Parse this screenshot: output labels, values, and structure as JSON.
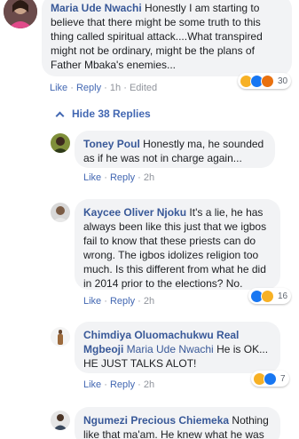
{
  "comments": [
    {
      "author": "Maria Ude Nwachi",
      "text": "Honestly I am starting to believe that there might be some truth to this thing called spiritual attack....What transpired might not be ordinary, might be the plans of Father Mbaka's enemies...",
      "like": "Like",
      "reply": "Reply",
      "time": "1h",
      "edited": "Edited",
      "reactions": [
        "haha-icon",
        "like-icon",
        "angry-icon"
      ],
      "reaction_count": "30"
    }
  ],
  "hide_replies": "Hide 38 Replies",
  "replies": [
    {
      "author": "Toney Poul",
      "text": "Honestly ma, he sounded as if he was not in charge again...",
      "like": "Like",
      "reply": "Reply",
      "time": "2h"
    },
    {
      "author": "Kaycee Oliver Njoku",
      "text": "It's a lie, he has always been like this just that we igbos fail to know that these priests can do wrong. The igbos idolizes religion too much. Is this different from what he did in 2014 prior to the elections? No.",
      "like": "Like",
      "reply": "Reply",
      "time": "2h",
      "reactions": [
        "like-icon",
        "haha-icon"
      ],
      "reaction_count": "16"
    },
    {
      "author": "Chimdiya Oluomachukwu Real Mgbeoji",
      "tag": "Maria Ude Nwachi",
      "text": "He is OK... HE JUST TALKS ALOT!",
      "like": "Like",
      "reply": "Reply",
      "time": "2h",
      "reactions": [
        "haha-icon",
        "like-icon"
      ],
      "reaction_count": "7"
    },
    {
      "author": "Ngumezi Precious Chiemeka",
      "text": "Nothing like that ma'am. He knew what he was"
    }
  ],
  "colors": {
    "link": "#385898",
    "action": "#4267b2",
    "bubble": "#f2f3f5",
    "meta": "#90949c"
  }
}
